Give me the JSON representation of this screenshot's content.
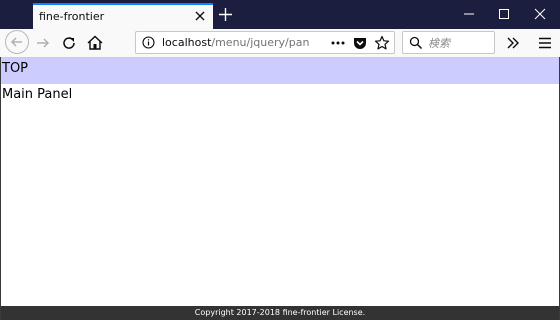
{
  "browser": {
    "tab": {
      "title": "fine-frontier"
    },
    "url": {
      "host": "localhost",
      "path": "/menu/jquery/pane"
    },
    "search": {
      "placeholder": "検索"
    },
    "colors": {
      "titlebar": "#1c1e3f",
      "tab_accent": "#0a84ff",
      "toolbar": "#f9f9fa"
    }
  },
  "page": {
    "top_bar": {
      "label": "TOP",
      "color": "#ccccff"
    },
    "main_panel": {
      "label": "Main Panel"
    },
    "footer": {
      "text": "Copyright 2017-2018 fine-frontier License.",
      "color": "#333333"
    }
  },
  "icons": {
    "tab_close": "close-icon",
    "new_tab": "plus-icon",
    "minimize": "minimize-icon",
    "maximize": "maximize-icon",
    "close_window": "close-icon",
    "back": "arrow-left-icon",
    "forward": "arrow-right-icon",
    "reload": "reload-icon",
    "home": "home-icon",
    "info": "info-icon",
    "page_actions": "more-dots-icon",
    "pocket": "pocket-icon",
    "bookmark": "star-icon",
    "search": "search-icon",
    "overflow": "chevron-double-right-icon",
    "menu": "hamburger-menu-icon"
  }
}
